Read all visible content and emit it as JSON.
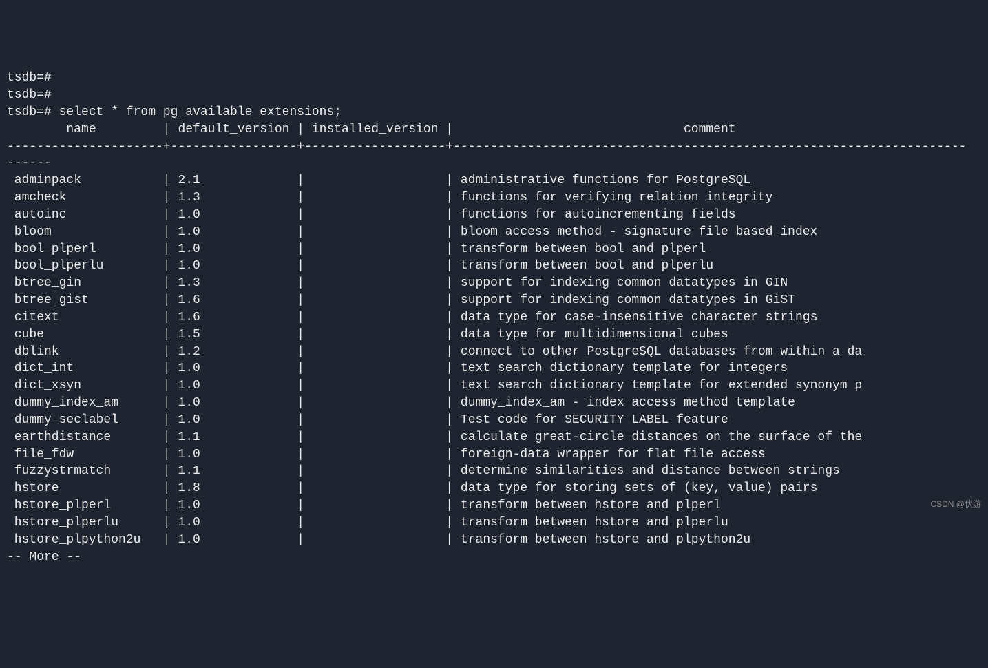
{
  "prompt_lines": [
    "tsdb=#",
    "tsdb=#",
    "tsdb=# select * from pg_available_extensions;"
  ],
  "columns": {
    "name": "name",
    "default_version": "default_version",
    "installed_version": "installed_version",
    "comment": "comment"
  },
  "separator": "---------------------+-----------------+-------------------+---------------------------------------------------------------------",
  "separator_tail": "------",
  "rows": [
    {
      "name": "adminpack",
      "default_version": "2.1",
      "installed_version": "",
      "comment": "administrative functions for PostgreSQL"
    },
    {
      "name": "amcheck",
      "default_version": "1.3",
      "installed_version": "",
      "comment": "functions for verifying relation integrity"
    },
    {
      "name": "autoinc",
      "default_version": "1.0",
      "installed_version": "",
      "comment": "functions for autoincrementing fields"
    },
    {
      "name": "bloom",
      "default_version": "1.0",
      "installed_version": "",
      "comment": "bloom access method - signature file based index"
    },
    {
      "name": "bool_plperl",
      "default_version": "1.0",
      "installed_version": "",
      "comment": "transform between bool and plperl"
    },
    {
      "name": "bool_plperlu",
      "default_version": "1.0",
      "installed_version": "",
      "comment": "transform between bool and plperlu"
    },
    {
      "name": "btree_gin",
      "default_version": "1.3",
      "installed_version": "",
      "comment": "support for indexing common datatypes in GIN"
    },
    {
      "name": "btree_gist",
      "default_version": "1.6",
      "installed_version": "",
      "comment": "support for indexing common datatypes in GiST"
    },
    {
      "name": "citext",
      "default_version": "1.6",
      "installed_version": "",
      "comment": "data type for case-insensitive character strings"
    },
    {
      "name": "cube",
      "default_version": "1.5",
      "installed_version": "",
      "comment": "data type for multidimensional cubes"
    },
    {
      "name": "dblink",
      "default_version": "1.2",
      "installed_version": "",
      "comment": "connect to other PostgreSQL databases from within a da"
    },
    {
      "name": "dict_int",
      "default_version": "1.0",
      "installed_version": "",
      "comment": "text search dictionary template for integers"
    },
    {
      "name": "dict_xsyn",
      "default_version": "1.0",
      "installed_version": "",
      "comment": "text search dictionary template for extended synonym p"
    },
    {
      "name": "dummy_index_am",
      "default_version": "1.0",
      "installed_version": "",
      "comment": "dummy_index_am - index access method template"
    },
    {
      "name": "dummy_seclabel",
      "default_version": "1.0",
      "installed_version": "",
      "comment": "Test code for SECURITY LABEL feature"
    },
    {
      "name": "earthdistance",
      "default_version": "1.1",
      "installed_version": "",
      "comment": "calculate great-circle distances on the surface of the"
    },
    {
      "name": "file_fdw",
      "default_version": "1.0",
      "installed_version": "",
      "comment": "foreign-data wrapper for flat file access"
    },
    {
      "name": "fuzzystrmatch",
      "default_version": "1.1",
      "installed_version": "",
      "comment": "determine similarities and distance between strings"
    },
    {
      "name": "hstore",
      "default_version": "1.8",
      "installed_version": "",
      "comment": "data type for storing sets of (key, value) pairs"
    },
    {
      "name": "hstore_plperl",
      "default_version": "1.0",
      "installed_version": "",
      "comment": "transform between hstore and plperl"
    },
    {
      "name": "hstore_plperlu",
      "default_version": "1.0",
      "installed_version": "",
      "comment": "transform between hstore and plperlu"
    },
    {
      "name": "hstore_plpython2u",
      "default_version": "1.0",
      "installed_version": "",
      "comment": "transform between hstore and plpython2u"
    }
  ],
  "pager": "-- More --",
  "watermark": "CSDN @伏游",
  "widths": {
    "name": 20,
    "default_version": 16,
    "installed_version": 18,
    "comment_header_pad": 38
  }
}
